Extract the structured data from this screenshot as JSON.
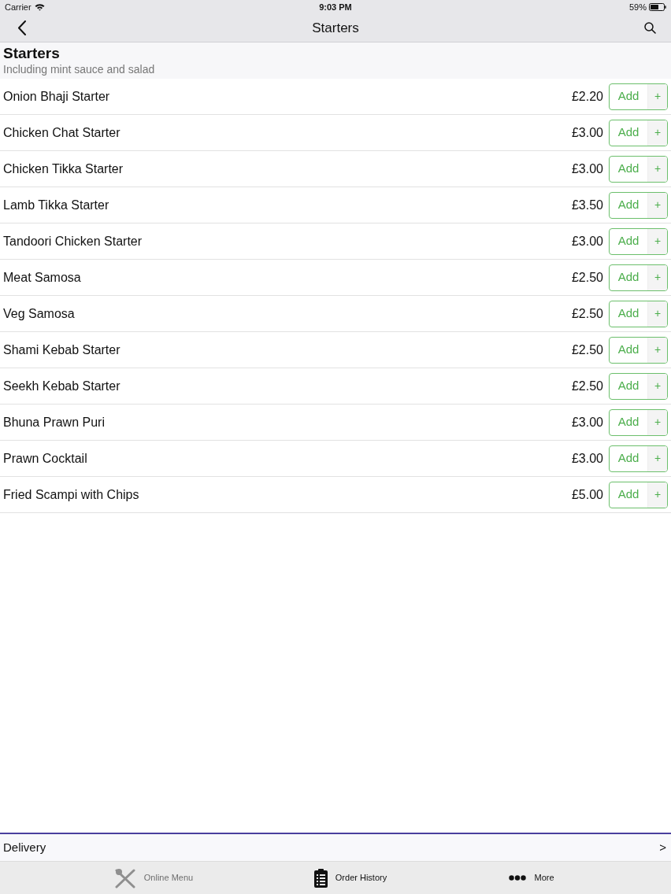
{
  "status_bar": {
    "carrier": "Carrier",
    "time": "9:03 PM",
    "battery": "59%"
  },
  "nav_bar": {
    "title": "Starters"
  },
  "section": {
    "title": "Starters",
    "subtitle": "Including mint sauce and salad"
  },
  "items": [
    {
      "name": "Onion Bhaji Starter",
      "price": "£2.20",
      "add_label": "Add",
      "plus": "+"
    },
    {
      "name": "Chicken Chat Starter",
      "price": "£3.00",
      "add_label": "Add",
      "plus": "+"
    },
    {
      "name": "Chicken Tikka Starter",
      "price": "£3.00",
      "add_label": "Add",
      "plus": "+"
    },
    {
      "name": "Lamb Tikka Starter",
      "price": "£3.50",
      "add_label": "Add",
      "plus": "+"
    },
    {
      "name": "Tandoori Chicken Starter",
      "price": "£3.00",
      "add_label": "Add",
      "plus": "+"
    },
    {
      "name": "Meat Samosa",
      "price": "£2.50",
      "add_label": "Add",
      "plus": "+"
    },
    {
      "name": "Veg Samosa",
      "price": "£2.50",
      "add_label": "Add",
      "plus": "+"
    },
    {
      "name": "Shami Kebab Starter",
      "price": "£2.50",
      "add_label": "Add",
      "plus": "+"
    },
    {
      "name": "Seekh Kebab Starter",
      "price": "£2.50",
      "add_label": "Add",
      "plus": "+"
    },
    {
      "name": "Bhuna Prawn Puri",
      "price": "£3.00",
      "add_label": "Add",
      "plus": "+"
    },
    {
      "name": "Prawn Cocktail",
      "price": "£3.00",
      "add_label": "Add",
      "plus": "+"
    },
    {
      "name": "Fried Scampi with Chips",
      "price": "£5.00",
      "add_label": "Add",
      "plus": "+"
    }
  ],
  "delivery": {
    "label": "Delivery",
    "chevron": ">"
  },
  "tab_bar": [
    {
      "label": "Online Menu",
      "selected": true
    },
    {
      "label": "Order History",
      "selected": false
    },
    {
      "label": "More",
      "selected": false
    }
  ]
}
